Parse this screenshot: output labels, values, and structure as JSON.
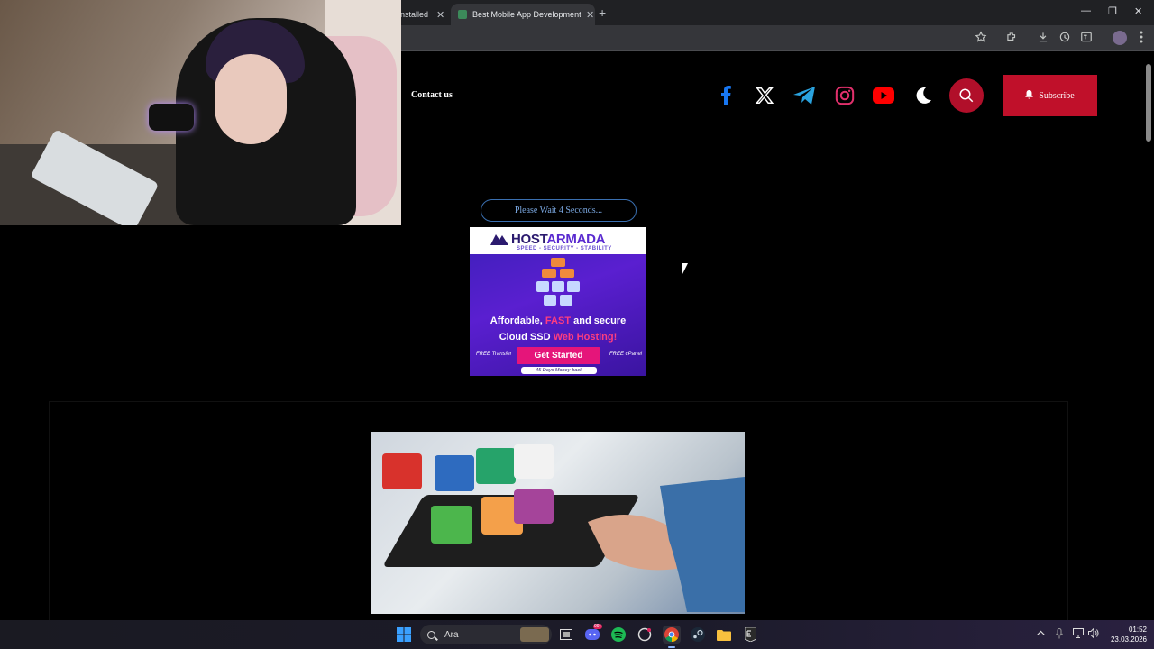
{
  "browser": {
    "tabs": [
      {
        "label": "nstalled"
      },
      {
        "label": "Best Mobile App Development"
      }
    ],
    "new_tab_symbol": "+",
    "window_controls": {
      "minimize": "—",
      "restore": "❐",
      "close": "✕"
    }
  },
  "site": {
    "nav": {
      "contact_label": "Contact us"
    },
    "social": [
      "facebook",
      "x",
      "telegram",
      "instagram",
      "youtube"
    ],
    "subscribe_label": "Subscribe",
    "wait_label": "Please Wait 4 Seconds...",
    "colors": {
      "accent_red": "#c0102a",
      "facebook": "#1877f2",
      "telegram": "#2aa3df",
      "instagram": "#e1306c",
      "youtube": "#ff0000"
    }
  },
  "ad": {
    "brand_prefix": "HOST",
    "brand_suffix": "ARMADA",
    "tagline": "SPEED - SECURITY - STABILITY",
    "headline_1a": "Affordable, ",
    "headline_1b": "FAST",
    "headline_1c": " and secure",
    "headline_2a": "Cloud SSD ",
    "headline_2b": "Web Hosting!",
    "free_left": "FREE Transfer",
    "free_right": "FREE cPanel",
    "cta": "Get Started",
    "guarantee": "45 Days Money-back"
  },
  "taskbar": {
    "search_placeholder": "Ara",
    "discord_badge": "99+",
    "time": "01:52",
    "date": "23.03.2026"
  }
}
